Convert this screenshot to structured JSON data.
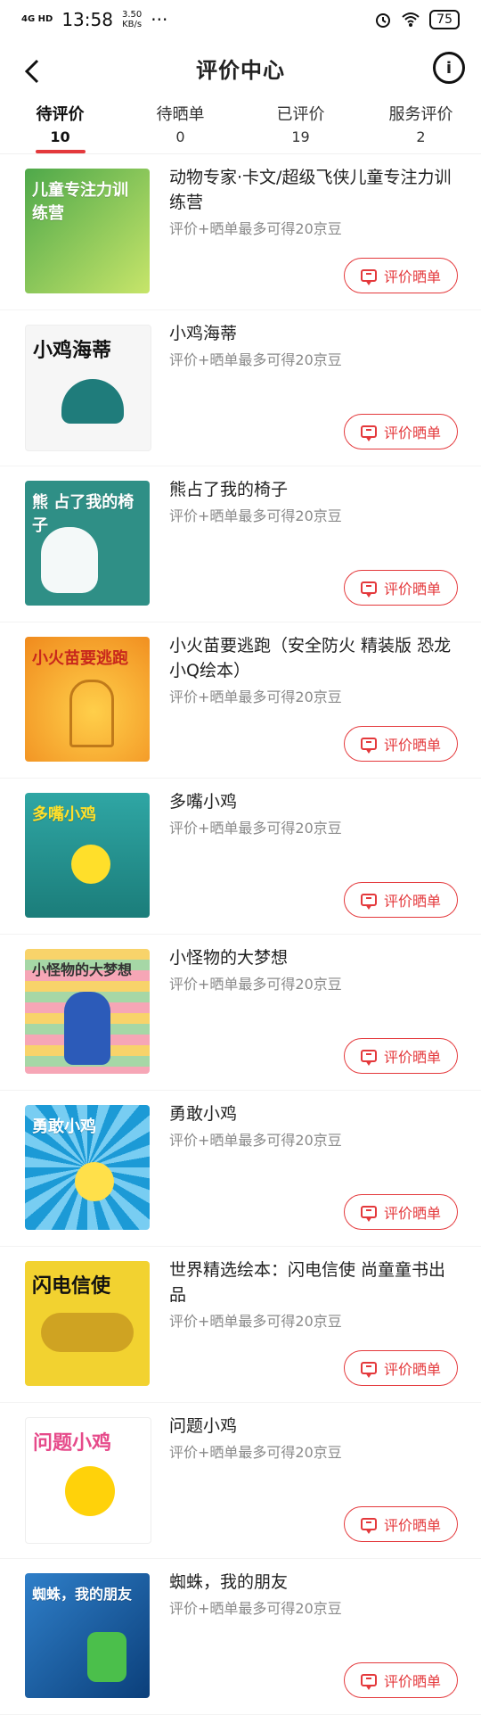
{
  "status_bar": {
    "network": "4G HD",
    "time": "13:58",
    "speed_value": "3.50",
    "speed_unit": "KB/s",
    "dots": "···",
    "battery": "75",
    "alarm_icon": "alarm-icon",
    "wifi_icon": "wifi-icon"
  },
  "header": {
    "title": "评价中心",
    "back_icon": "chevron-left-icon",
    "info_icon": "info-icon"
  },
  "tabs": [
    {
      "label": "待评价",
      "count": "10",
      "active": true
    },
    {
      "label": "待晒单",
      "count": "0",
      "active": false
    },
    {
      "label": "已评价",
      "count": "19",
      "active": false
    },
    {
      "label": "服务评价",
      "count": "2",
      "active": false
    }
  ],
  "colors": {
    "accent": "#e4393c",
    "promo_text": "#8a8a8a"
  },
  "items": [
    {
      "name": "动物专家·卡文/超级飞侠儿童专注力训练营",
      "promo": "评价+晒单最多可得20京豆",
      "button": "评价晒单",
      "cover_bg": "#4ea84a",
      "cover_text": "儿童专注力训练营"
    },
    {
      "name": "小鸡海蒂",
      "promo": "评价+晒单最多可得20京豆",
      "button": "评价晒单",
      "cover_bg": "#f6f6f6",
      "cover_text": "小鸡海蒂"
    },
    {
      "name": "熊占了我的椅子",
      "promo": "评价+晒单最多可得20京豆",
      "button": "评价晒单",
      "cover_bg": "#2f8f86",
      "cover_text": "熊 占了我的椅子"
    },
    {
      "name": "小火苗要逃跑（安全防火 精装版 恐龙小Q绘本）",
      "promo": "评价+晒单最多可得20京豆",
      "button": "评价晒单",
      "cover_bg": "#f0a51e",
      "cover_text": "小火苗要逃跑"
    },
    {
      "name": "多嘴小鸡",
      "promo": "评价+晒单最多可得20京豆",
      "button": "评价晒单",
      "cover_bg": "#2fa6a4",
      "cover_text": "多嘴小鸡"
    },
    {
      "name": "小怪物的大梦想",
      "promo": "评价+晒单最多可得20京豆",
      "button": "评价晒单",
      "cover_bg": "#f8d36a",
      "cover_text": "小怪物的大梦想"
    },
    {
      "name": "勇敢小鸡",
      "promo": "评价+晒单最多可得20京豆",
      "button": "评价晒单",
      "cover_bg": "#1c9ad6",
      "cover_text": "勇敢小鸡"
    },
    {
      "name": "世界精选绘本：闪电信使 尚童童书出品",
      "promo": "评价+晒单最多可得20京豆",
      "button": "评价晒单",
      "cover_bg": "#f2d230",
      "cover_text": "闪电信使"
    },
    {
      "name": "问题小鸡",
      "promo": "评价+晒单最多可得20京豆",
      "button": "评价晒单",
      "cover_bg": "#ffffff",
      "cover_text": "问题小鸡"
    },
    {
      "name": "蜘蛛，我的朋友",
      "promo": "评价+晒单最多可得20京豆",
      "button": "评价晒单",
      "cover_bg": "#2f7fc9",
      "cover_text": "蜘蛛，我的朋友"
    }
  ]
}
